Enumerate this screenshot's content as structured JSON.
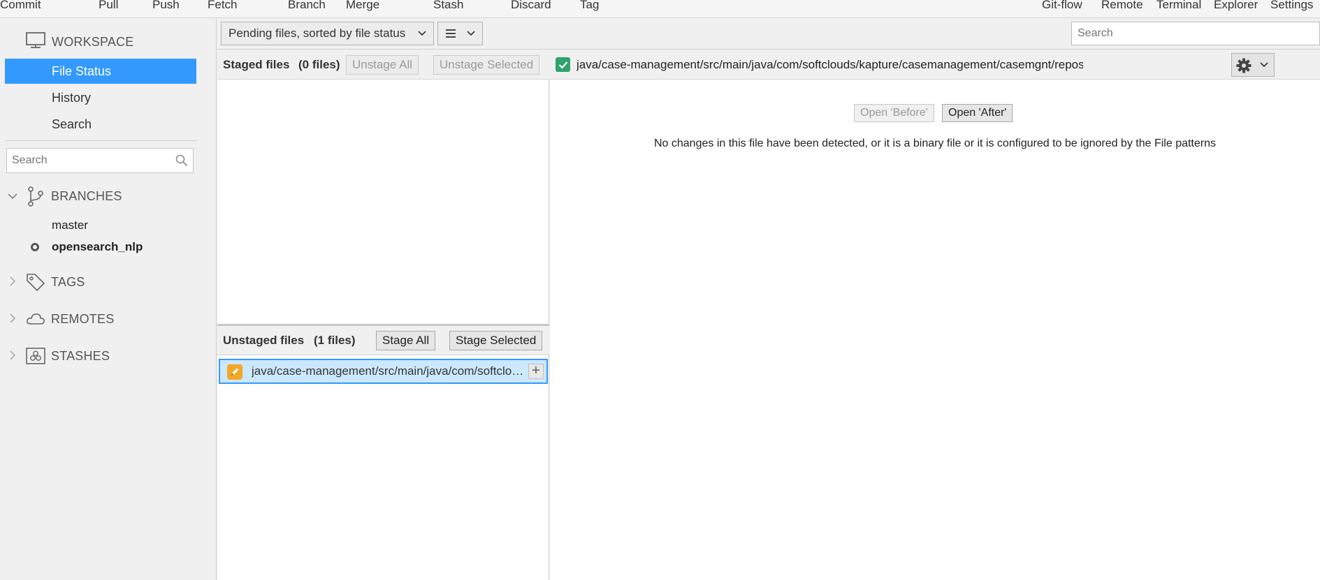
{
  "toolbar": {
    "items": [
      "Commit",
      "Pull",
      "Push",
      "Fetch",
      "Branch",
      "Merge",
      "Stash",
      "Discard",
      "Tag"
    ],
    "right_items": [
      "Git-flow",
      "Remote",
      "Terminal",
      "Explorer",
      "Settings"
    ]
  },
  "sidebar": {
    "workspace_label": "WORKSPACE",
    "workspace_items": [
      "File Status",
      "History",
      "Search"
    ],
    "active_item": "File Status",
    "search_placeholder": "Search",
    "branches_label": "BRANCHES",
    "branches": [
      "master",
      "opensearch_nlp"
    ],
    "current_branch": "opensearch_nlp",
    "tags_label": "TAGS",
    "remotes_label": "REMOTES",
    "stashes_label": "STASHES"
  },
  "filter": {
    "sort_label": "Pending files, sorted by file status",
    "view_icon": "list-icon",
    "search_placeholder": "Search"
  },
  "staged": {
    "title": "Staged files",
    "count": "(0 files)",
    "unstage_all": "Unstage All",
    "unstage_selected": "Unstage Selected"
  },
  "unstaged": {
    "title": "Unstaged files",
    "count": "(1 files)",
    "stage_all": "Stage All",
    "stage_selected": "Stage Selected",
    "files": [
      "java/case-management/src/main/java/com/softclouds/kapture/casemanagement/casemgnt/repository/elasticsearch/KAnalytics.java"
    ]
  },
  "diff": {
    "file_path": "java/case-management/src/main/java/com/softclouds/kapture/casemanagement/casemgnt/repository/elasticsearch/KAnalytics.java",
    "open_before": "Open 'Before'",
    "open_after": "Open 'After'",
    "message": "No changes in this file have been detected, or it is a binary file or it is configured to be ignored by the File patterns"
  },
  "colors": {
    "accent": "#3399ff",
    "selected_row": "#cce8ff",
    "modified_badge": "#f5a623",
    "staged_check": "#2fa36b"
  }
}
